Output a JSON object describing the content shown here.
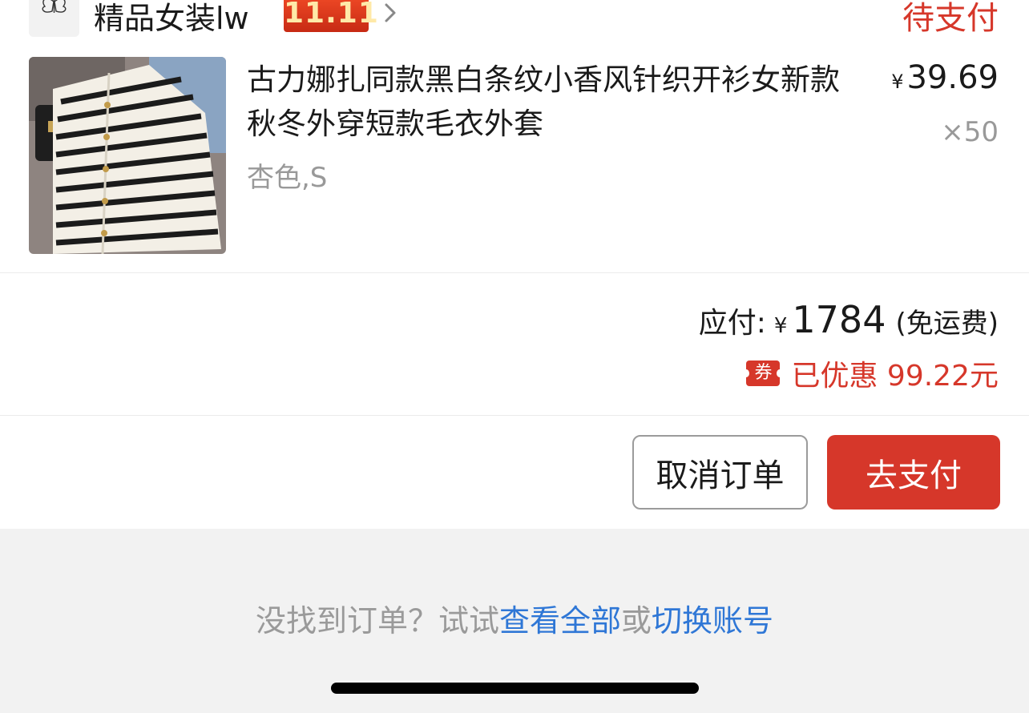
{
  "shop": {
    "name": "精品女装lw",
    "logo_text": "精品女装lw",
    "promo_badge": "11.11",
    "order_status": "待支付"
  },
  "product": {
    "title": "古力娜扎同款黑白条纹小香风针织开衫女新款秋冬外穿短款毛衣外套",
    "sku": "杏色,S",
    "price_currency": "¥",
    "price": "39.69",
    "quantity": "×50"
  },
  "totals": {
    "label": "应付:",
    "currency": "¥",
    "amount": "1784",
    "shipping_note": "(免运费)",
    "coupon_icon_label": "券",
    "discount_text": "已优惠 99.22元"
  },
  "actions": {
    "cancel_label": "取消订单",
    "pay_label": "去支付"
  },
  "footer": {
    "hint_prefix": "没找到订单？试试",
    "view_all_link": "查看全部",
    "or_text": "或",
    "switch_account_link": "切换账号"
  },
  "colors": {
    "accent_red": "#d6372a",
    "link_blue": "#2f77d6",
    "muted_gray": "#999999",
    "footer_bg": "#f2f2f2"
  },
  "icons": [
    "shop-logo",
    "chevron-right-icon",
    "coupon-icon",
    "product-image"
  ]
}
